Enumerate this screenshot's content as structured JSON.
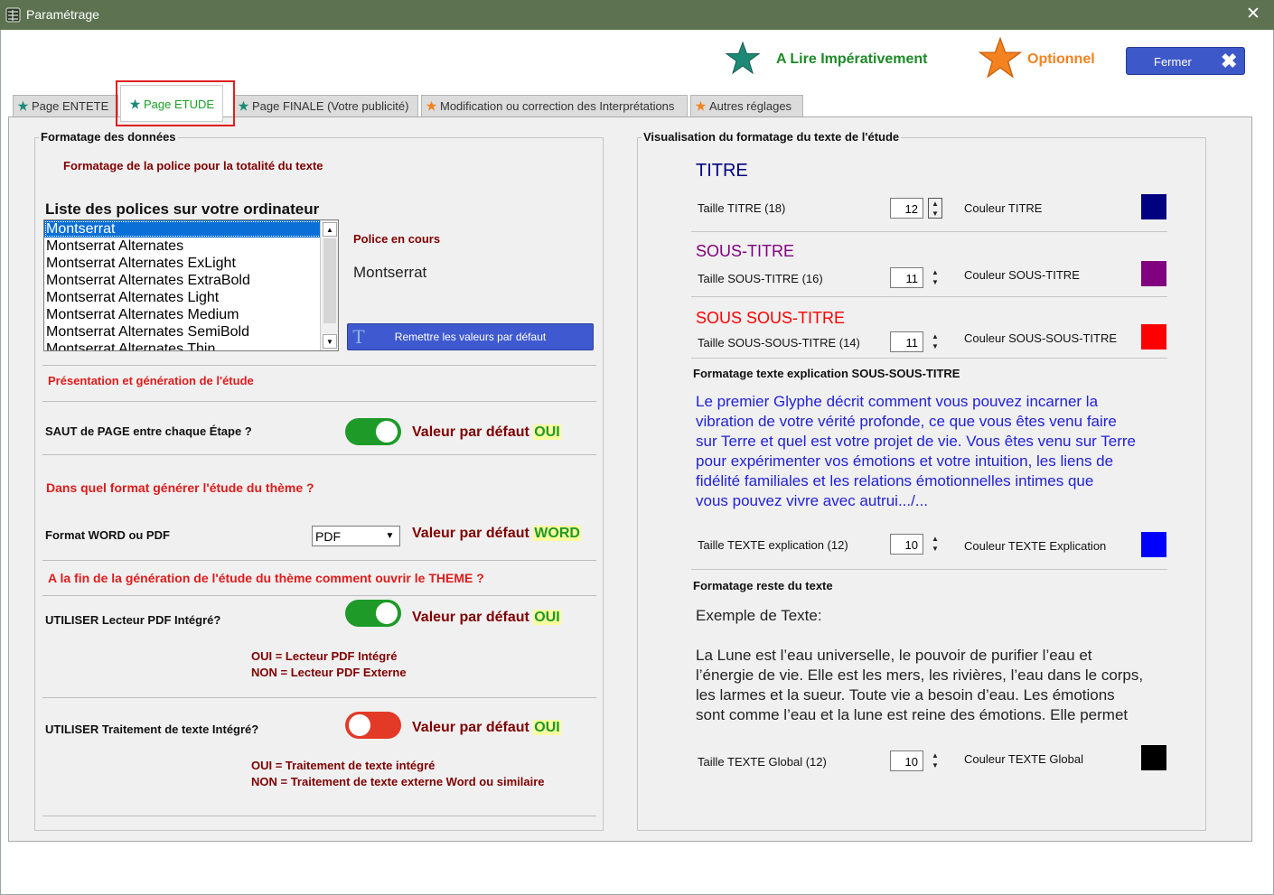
{
  "window": {
    "title": "Paramétrage",
    "close_glyph": "✕"
  },
  "legend": {
    "required_label": "A Lire Impérativement",
    "optional_label": "Optionnel",
    "required_color": "#1d8a78",
    "optional_color": "#f58220",
    "close_button": "Fermer",
    "close_glyph": "✖"
  },
  "tabs": [
    {
      "label": "Page ENTETE",
      "star": "teal"
    },
    {
      "label": "Page ETUDE",
      "star": "teal",
      "active": true
    },
    {
      "label": "Page FINALE (Votre publicité)",
      "star": "teal"
    },
    {
      "label": "Modification ou correction des Interprétations",
      "star": "orange"
    },
    {
      "label": "Autres réglages",
      "star": "orange"
    }
  ],
  "left": {
    "group_title": "Formatage des données",
    "font_format_heading": "Formatage de la police pour la totalité du texte",
    "font_list_label": "Liste des polices sur votre ordinateur",
    "font_list": [
      "Montserrat",
      "Montserrat Alternates",
      "Montserrat Alternates ExLight",
      "Montserrat Alternates ExtraBold",
      "Montserrat Alternates Light",
      "Montserrat Alternates Medium",
      "Montserrat Alternates SemiBold",
      "Montserrat Alternates Thin"
    ],
    "selected_font_index": 0,
    "current_font_label": "Police en cours",
    "current_font_value": "Montserrat",
    "reset_button": "Remettre les valeurs par défaut",
    "presentation_heading": "Présentation et génération de l'étude",
    "page_break": {
      "label": "SAUT de PAGE entre chaque Étape ?",
      "state": "on",
      "default_prefix": "Valeur par défaut",
      "default_value": "OUI"
    },
    "format_question": "Dans quel format générer l'étude du thème ?",
    "format": {
      "label": "Format WORD ou PDF",
      "value": "PDF",
      "default_prefix": "Valeur par défaut",
      "default_value": "WORD"
    },
    "open_question": "A la fin de la génération de l'étude du thème comment ouvrir le THEME ?",
    "pdf_reader": {
      "label": "UTILISER Lecteur PDF Intégré?",
      "state": "on",
      "default_prefix": "Valeur par défaut",
      "default_value": "OUI",
      "note_yes": "OUI = Lecteur PDF Intégré",
      "note_no": "NON = Lecteur PDF Externe"
    },
    "word_processor": {
      "label": "UTILISER Traitement de texte Intégré?",
      "state": "off",
      "default_prefix": "Valeur par défaut",
      "default_value": "OUI",
      "note_yes": "OUI = Traitement de texte intégré",
      "note_no": "NON = Traitement de texte externe Word ou similaire"
    }
  },
  "right": {
    "group_title": "Visualisation du formatage du texte de l'étude",
    "titre": {
      "preview": "TITRE",
      "size_label": "Taille TITRE (18)",
      "size": "12",
      "color_label": "Couleur TITRE",
      "color": "#000080"
    },
    "sous_titre": {
      "preview": "SOUS-TITRE",
      "size_label": "Taille SOUS-TITRE (16)",
      "size": "11",
      "color_label": "Couleur SOUS-TITRE",
      "color": "#800080"
    },
    "sous_sous_titre": {
      "preview": "SOUS SOUS-TITRE",
      "size_label": "Taille SOUS-SOUS-TITRE (14)",
      "size": "11",
      "color_label": "Couleur SOUS-SOUS-TITRE",
      "color": "#ff0000"
    },
    "explication": {
      "heading": "Formatage texte explication SOUS-SOUS-TITRE",
      "lines": [
        "Le premier Glyphe décrit comment vous pouvez incarner la",
        "vibration de votre vérité profonde, ce que vous êtes venu faire",
        "sur Terre et quel est votre projet de vie. Vous êtes venu sur Terre",
        "pour expérimenter vos émotions et votre intuition, les liens de",
        "fidélité familiales et les relations émotionnelles intimes que",
        "vous pouvez vivre avec autrui.../..."
      ],
      "size_label": "Taille TEXTE explication (12)",
      "size": "10",
      "color_label": "Couleur TEXTE Explication",
      "color": "#0000ff"
    },
    "global": {
      "heading": "Formatage reste du texte",
      "example_title": "Exemple de Texte:",
      "lines": [
        "La Lune est l’eau universelle, le pouvoir de purifier l’eau et",
        "l’énergie de vie. Elle est les mers, les rivières, l’eau dans le corps,",
        "les larmes et la sueur. Toute vie a besoin d’eau. Les émotions",
        "sont comme l’eau et la lune est reine des émotions. Elle permet"
      ],
      "size_label": "Taille TEXTE Global (12)",
      "size": "10",
      "color_label": "Couleur TEXTE Global",
      "color": "#000000"
    }
  }
}
